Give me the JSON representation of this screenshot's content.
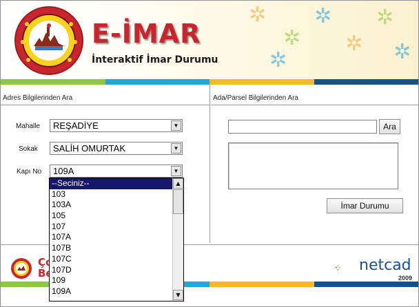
{
  "header": {
    "title": "E-İMAR",
    "subtitle": "İnteraktif İmar Durumu"
  },
  "colors": {
    "title": "#c8262e",
    "stripe": [
      "#8dc63f",
      "#29a3dc",
      "#f5b92a",
      "#16508e"
    ]
  },
  "left_panel": {
    "heading": "Adres Bilgilerinden Ara",
    "mahalle": {
      "label": "Mahalle",
      "value": "REŞADİYE"
    },
    "sokak": {
      "label": "Sokak",
      "value": "SALİH OMURTAK"
    },
    "kapi_no": {
      "label": "Kapı No",
      "value": "109A"
    }
  },
  "right_panel": {
    "heading": "Ada/Parsel Bilgilerinden Ara",
    "search_button": "Ara",
    "imar_button": "İmar Durumu"
  },
  "dropdown": {
    "options": [
      "--Seciniz--",
      "103",
      "103A",
      "105",
      "107",
      "107A",
      "107B",
      "107C",
      "107D",
      "109",
      "109A"
    ],
    "selected_index": 0
  },
  "footer": {
    "left_text_1": "Ço",
    "left_text_2": "Be",
    "brand": "netcad",
    "year": "2009"
  }
}
